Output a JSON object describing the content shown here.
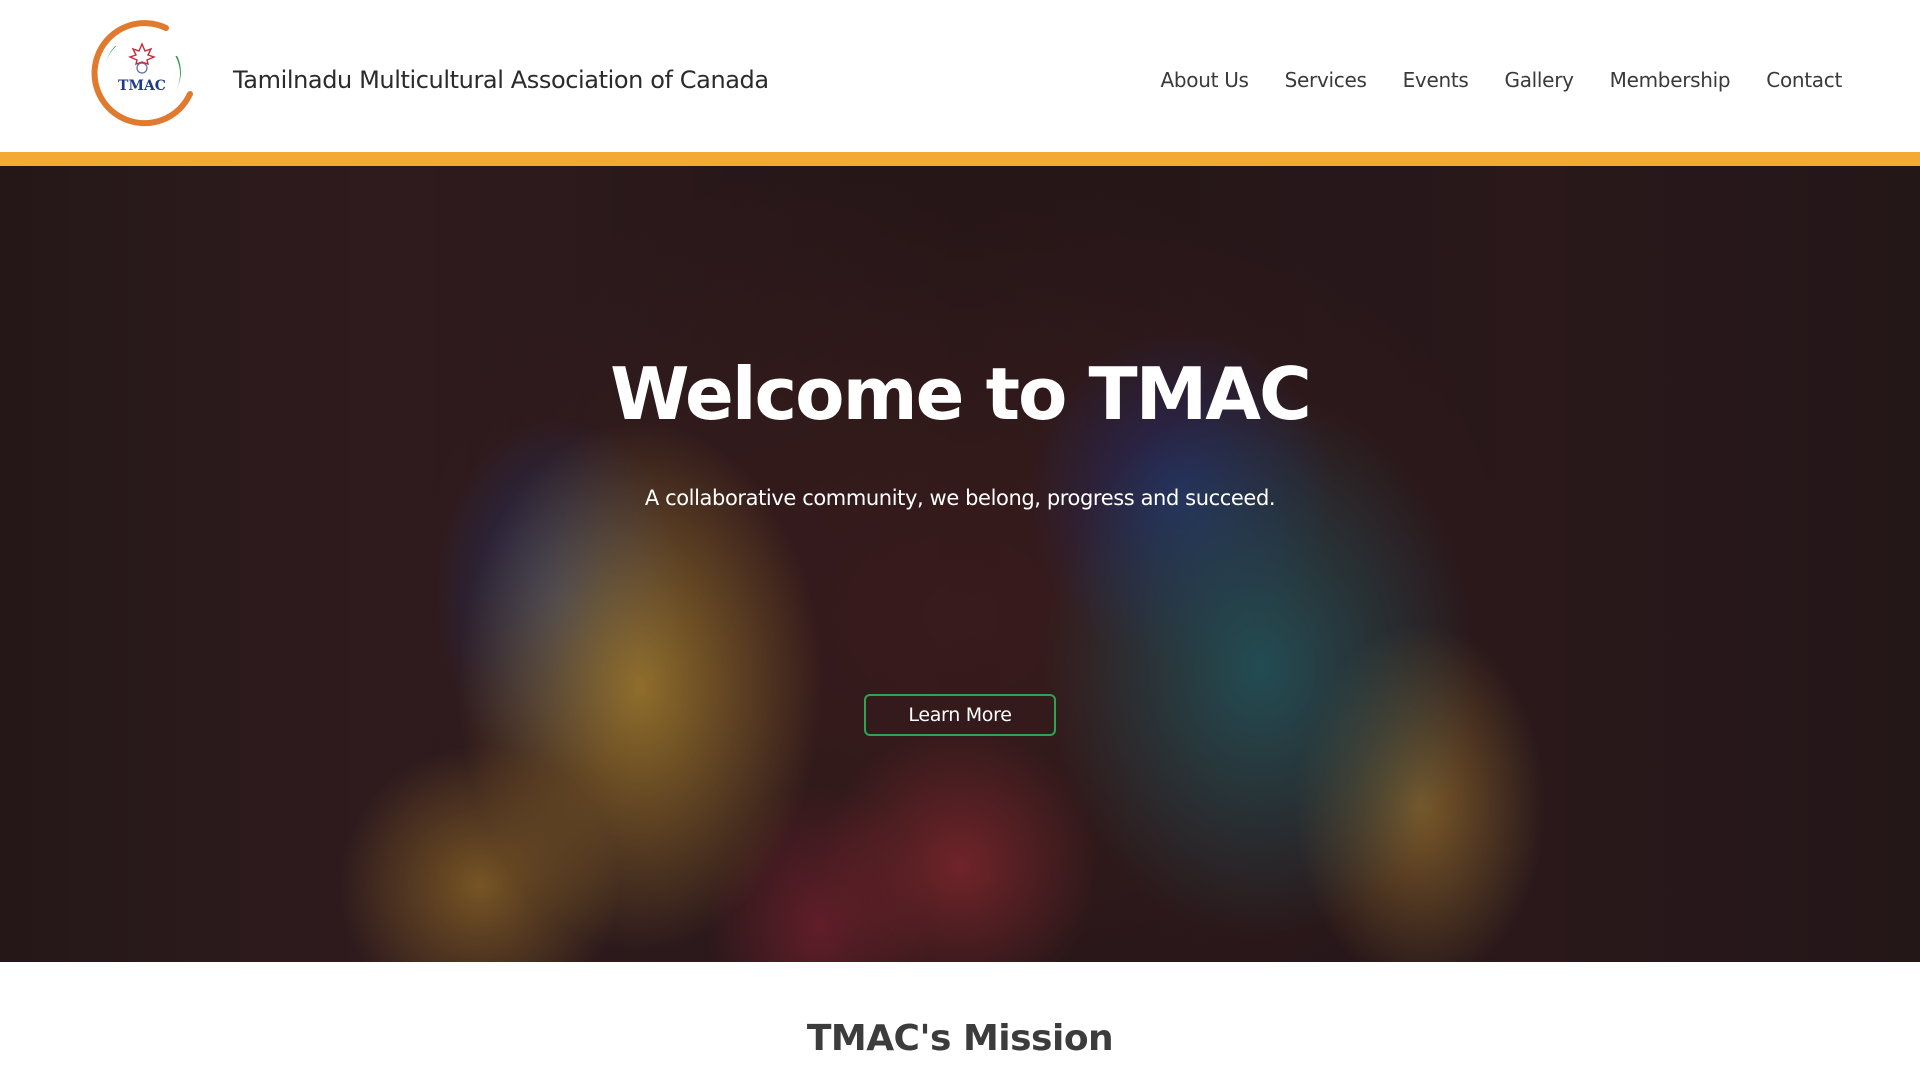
{
  "header": {
    "logo_text": "TMAC",
    "brand_name": "Tamilnadu Multicultural Association of Canada",
    "nav": [
      {
        "label": "About Us"
      },
      {
        "label": "Services"
      },
      {
        "label": "Events"
      },
      {
        "label": "Gallery"
      },
      {
        "label": "Membership"
      },
      {
        "label": "Contact"
      }
    ],
    "accent_color": "#f4a933"
  },
  "hero": {
    "title": "Welcome to TMAC",
    "subtitle": "A collaborative community, we belong, progress and succeed.",
    "button_label": "Learn More",
    "button_border_color": "#2fa34f"
  },
  "mission": {
    "heading": "TMAC's Mission"
  }
}
